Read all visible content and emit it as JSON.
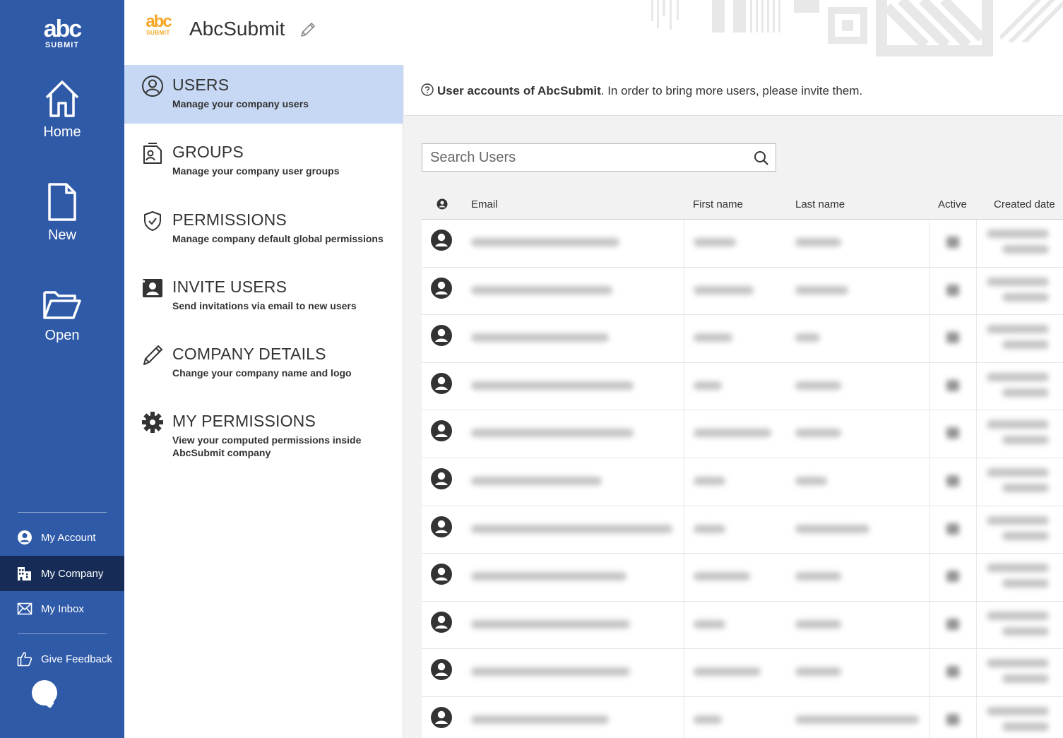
{
  "rail": {
    "logo_glyph": "abc",
    "logo_sub": "SUBMIT",
    "home": "Home",
    "new": "New",
    "open": "Open",
    "my_account": "My Account",
    "my_company": "My Company",
    "my_inbox": "My Inbox",
    "give_feedback": "Give Feedback"
  },
  "header": {
    "logo_glyph": "abc",
    "logo_sub": "SUBMIT",
    "company_name": "AbcSubmit"
  },
  "subnav": [
    {
      "title": "USERS",
      "desc": "Manage your company users",
      "icon": "user-circle-icon",
      "active": true
    },
    {
      "title": "GROUPS",
      "desc": "Manage your company user groups",
      "icon": "group-file-icon",
      "active": false
    },
    {
      "title": "PERMISSIONS",
      "desc": "Manage company default global permissions",
      "icon": "shield-check-icon",
      "active": false
    },
    {
      "title": "INVITE USERS",
      "desc": "Send invitations via email to new users",
      "icon": "contact-card-icon",
      "active": false
    },
    {
      "title": "COMPANY DETAILS",
      "desc": "Change your company name and logo",
      "icon": "pencil-icon",
      "active": false
    },
    {
      "title": "MY PERMISSIONS",
      "desc": "View your computed permissions inside AbcSubmit company",
      "icon": "gear-icon",
      "active": false
    }
  ],
  "info": {
    "bold": "User accounts of AbcSubmit",
    "rest": ". In order to bring more users, please invite them."
  },
  "search": {
    "placeholder": "Search Users"
  },
  "table": {
    "columns": [
      "Email",
      "First name",
      "Last name",
      "Active",
      "Created date"
    ]
  },
  "colors": {
    "rail": "#2f5aa8",
    "rail_active": "#162c56",
    "subnav_active": "#c6d8f3",
    "brand_accent": "#f5a623"
  }
}
